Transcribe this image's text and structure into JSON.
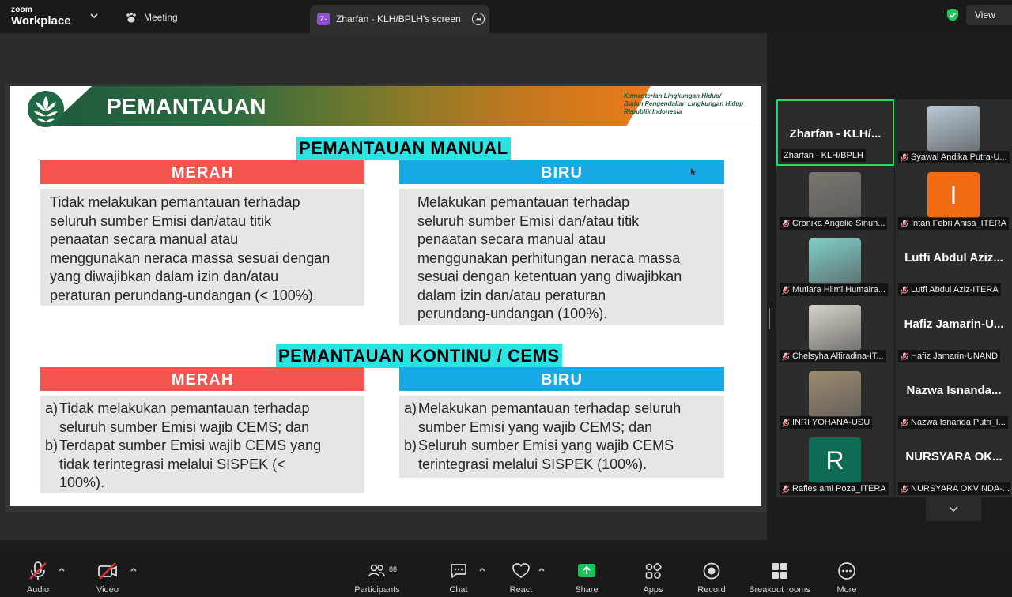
{
  "topbar": {
    "brand_small": "zoom",
    "brand_big": "Workplace",
    "meeting_label": "Meeting",
    "share_tab_icon": "Z-",
    "share_tab_label": "Zharfan - KLH/BPLH's screen",
    "view_label": "View"
  },
  "slide": {
    "title": "PEMANTAUAN",
    "ministry": [
      "Kementerian Lingkungan Hidup/",
      "Badan Pengendalian Lingkungan Hidup",
      "Republik Indonesia"
    ],
    "manual": {
      "heading": "PEMANTAUAN MANUAL",
      "red_label": "MERAH",
      "blue_label": "BIRU",
      "red_lines": [
        "Tidak melakukan pemantauan terhadap",
        "seluruh sumber Emisi  dan/atau titik",
        "penaatan  secara manual atau",
        "menggunakan neraca  massa sesuai dengan",
        "yang  diwajibkan dalam izin dan/atau",
        "peraturan  perundang-undangan (<  100%)."
      ],
      "blue_lines": [
        "Melakukan pemantauan  terhadap",
        "seluruh sumber Emisi  dan/atau titik",
        "penaatan  secara manual atau",
        "menggunakan perhitungan neraca massa",
        "sesuai dengan ketentuan yang diwajibkan",
        "dalam izin dan/atau   peraturan",
        "perundang-undangan (100%)."
      ]
    },
    "cems": {
      "heading": "PEMANTAUAN KONTINU / CEMS",
      "red_label": "MERAH",
      "blue_label": "BIRU",
      "red_items": [
        {
          "label": "a)",
          "lines": [
            "Tidak melakukan pemantauan terhadap",
            "seluruh sumber Emisi  wajib CEMS; dan"
          ]
        },
        {
          "label": "b)",
          "lines": [
            "Terdapat sumber Emisi  wajib CEMS yang",
            "tidak  terintegrasi melalui  SISPEK (<",
            "100%)."
          ]
        }
      ],
      "blue_items": [
        {
          "label": "a)",
          "lines": [
            "Melakukan pemantauan  terhadap seluruh",
            "sumber  Emisi yang wajib CEMS;  dan"
          ]
        },
        {
          "label": "b)",
          "lines": [
            "Seluruh sumber Emisi yang wajib CEMS",
            "terintegrasi melalui SISPEK (100%)."
          ]
        }
      ]
    }
  },
  "participants": [
    {
      "display": "Zharfan - KLH/...",
      "name": "Zharfan - KLH/BPLH",
      "kind": "text",
      "muted": false,
      "active": true
    },
    {
      "display": "",
      "name": "Syawal Andika Putra-U...",
      "kind": "photo",
      "color": "#b8c9d6",
      "muted": true
    },
    {
      "display": "",
      "name": "Cronika Angelie Sinuh...",
      "kind": "photo",
      "color": "#7a756e",
      "muted": true
    },
    {
      "display": "I",
      "name": "Intan Febri Anisa_ITERA",
      "kind": "initial",
      "color": "#f26b12",
      "muted": true
    },
    {
      "display": "",
      "name": "Mutiara Hilmi Humaira...",
      "kind": "photo",
      "color": "#7fd0c9",
      "muted": true
    },
    {
      "display": "Lutfi  Abdul  Aziz...",
      "name": "Lutfi Abdul Aziz-ITERA",
      "kind": "text",
      "muted": true
    },
    {
      "display": "",
      "name": "Chelsyha Alfiradina-IT...",
      "kind": "photo",
      "color": "#d8d2c8",
      "muted": true
    },
    {
      "display": "Hafiz  Jamarin-U...",
      "name": "Hafiz Jamarin-UNAND",
      "kind": "text",
      "muted": true
    },
    {
      "display": "",
      "name": "INRI YOHANA-USU",
      "kind": "photo",
      "color": "#9c8a6e",
      "muted": true
    },
    {
      "display": "Nazwa  Isnanda...",
      "name": "Nazwa Isnanda Putri_I...",
      "kind": "text",
      "muted": true
    },
    {
      "display": "R",
      "name": "Rafles ami Poza_ITERA",
      "kind": "initial",
      "color": "#0e6b54",
      "muted": true
    },
    {
      "display": "NURSYARA  OK...",
      "name": "NURSYARA OKVINDA-...",
      "kind": "text",
      "muted": true
    }
  ],
  "toolbar": {
    "audio": "Audio",
    "video": "Video",
    "participants": "Participants",
    "participants_count": "88",
    "chat": "Chat",
    "react": "React",
    "share": "Share",
    "apps": "Apps",
    "record": "Record",
    "breakout": "Breakout rooms",
    "more": "More"
  },
  "colors": {
    "active_speaker": "#23d96a",
    "share_green": "#1fbf5a",
    "muted_red": "#e0383e",
    "red_bar": "#f5554f",
    "blue_bar": "#16a9e5",
    "heading_highlight": "#2ae3e3"
  }
}
